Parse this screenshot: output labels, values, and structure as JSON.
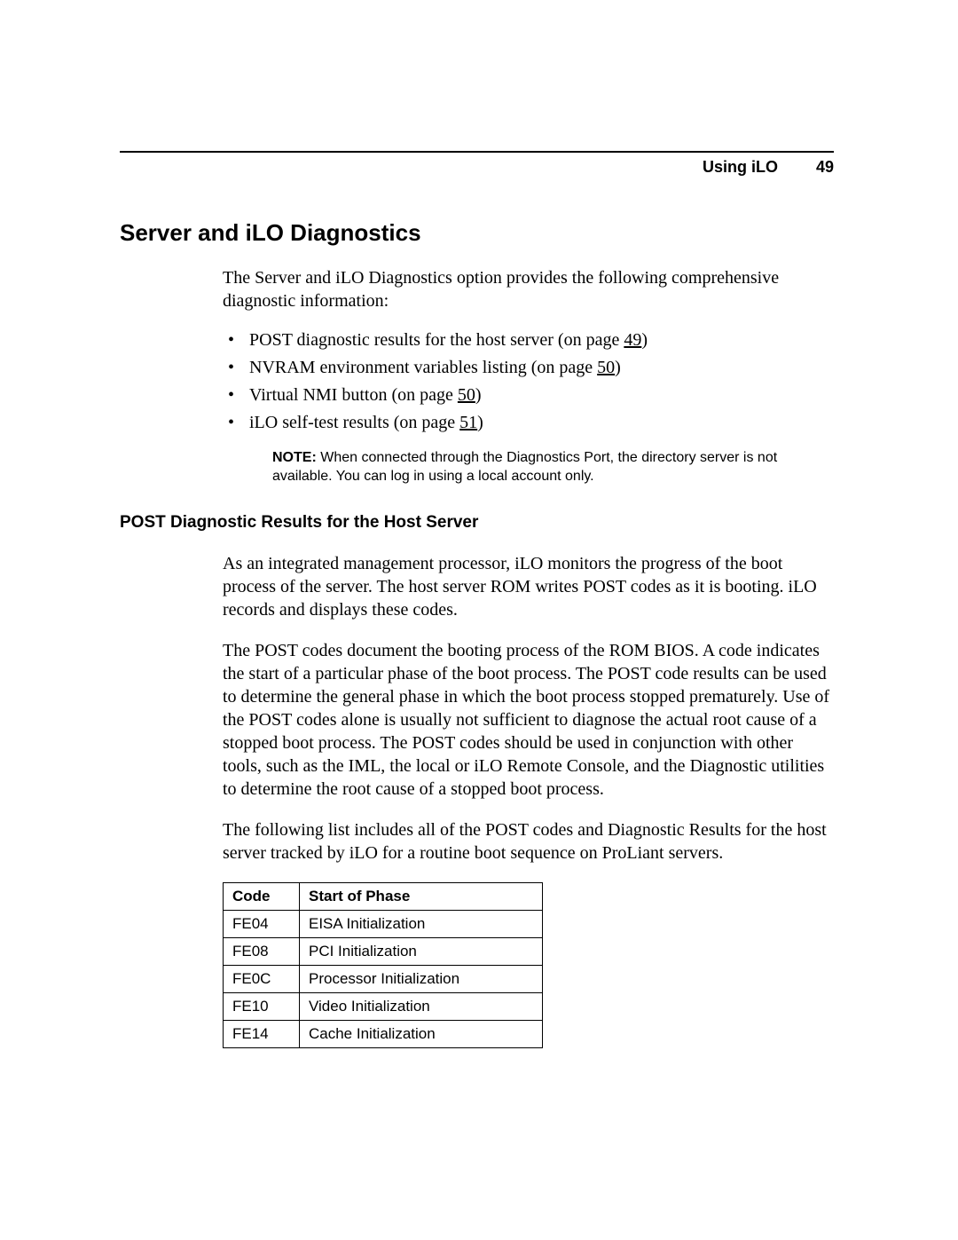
{
  "header": {
    "section": "Using iLO",
    "page_number": "49"
  },
  "title": "Server and iLO Diagnostics",
  "intro": "The Server and iLO Diagnostics option provides the following comprehensive diagnostic information:",
  "bullets": [
    {
      "pre": "POST diagnostic results for the host server (on page ",
      "link": "49",
      "post": ")"
    },
    {
      "pre": "NVRAM environment variables listing (on page ",
      "link": "50",
      "post": ")"
    },
    {
      "pre": "Virtual NMI button (on page ",
      "link": "50",
      "post": ")"
    },
    {
      "pre": "iLO self-test results (on page ",
      "link": "51",
      "post": ")"
    }
  ],
  "note": {
    "label": "NOTE:",
    "text": "  When connected through the Diagnostics Port, the directory server is not available. You can log in using a local account only."
  },
  "subheading": "POST Diagnostic Results for the Host Server",
  "para1": "As an integrated management processor, iLO monitors the progress of the boot process of the server. The host server ROM writes POST codes as it is booting. iLO records and displays these codes.",
  "para2": "The POST codes document the booting process of the ROM BIOS. A code indicates the start of a particular phase of the boot process. The POST code results can be used to determine the general phase in which the boot process stopped prematurely. Use of the POST codes alone is usually not sufficient to diagnose the actual root cause of a stopped boot process. The POST codes should be used in conjunction with other tools, such as the IML, the local or iLO Remote Console, and the Diagnostic utilities to determine the root cause of a stopped boot process.",
  "para3": "The following list includes all of the POST codes and Diagnostic Results for the host server tracked by iLO for a routine boot sequence on ProLiant servers.",
  "table": {
    "headers": {
      "code": "Code",
      "phase": "Start of Phase"
    },
    "rows": [
      {
        "code": "FE04",
        "phase": "EISA Initialization"
      },
      {
        "code": "FE08",
        "phase": "PCI Initialization"
      },
      {
        "code": "FE0C",
        "phase": "Processor Initialization"
      },
      {
        "code": "FE10",
        "phase": "Video Initialization"
      },
      {
        "code": "FE14",
        "phase": "Cache Initialization"
      }
    ]
  }
}
